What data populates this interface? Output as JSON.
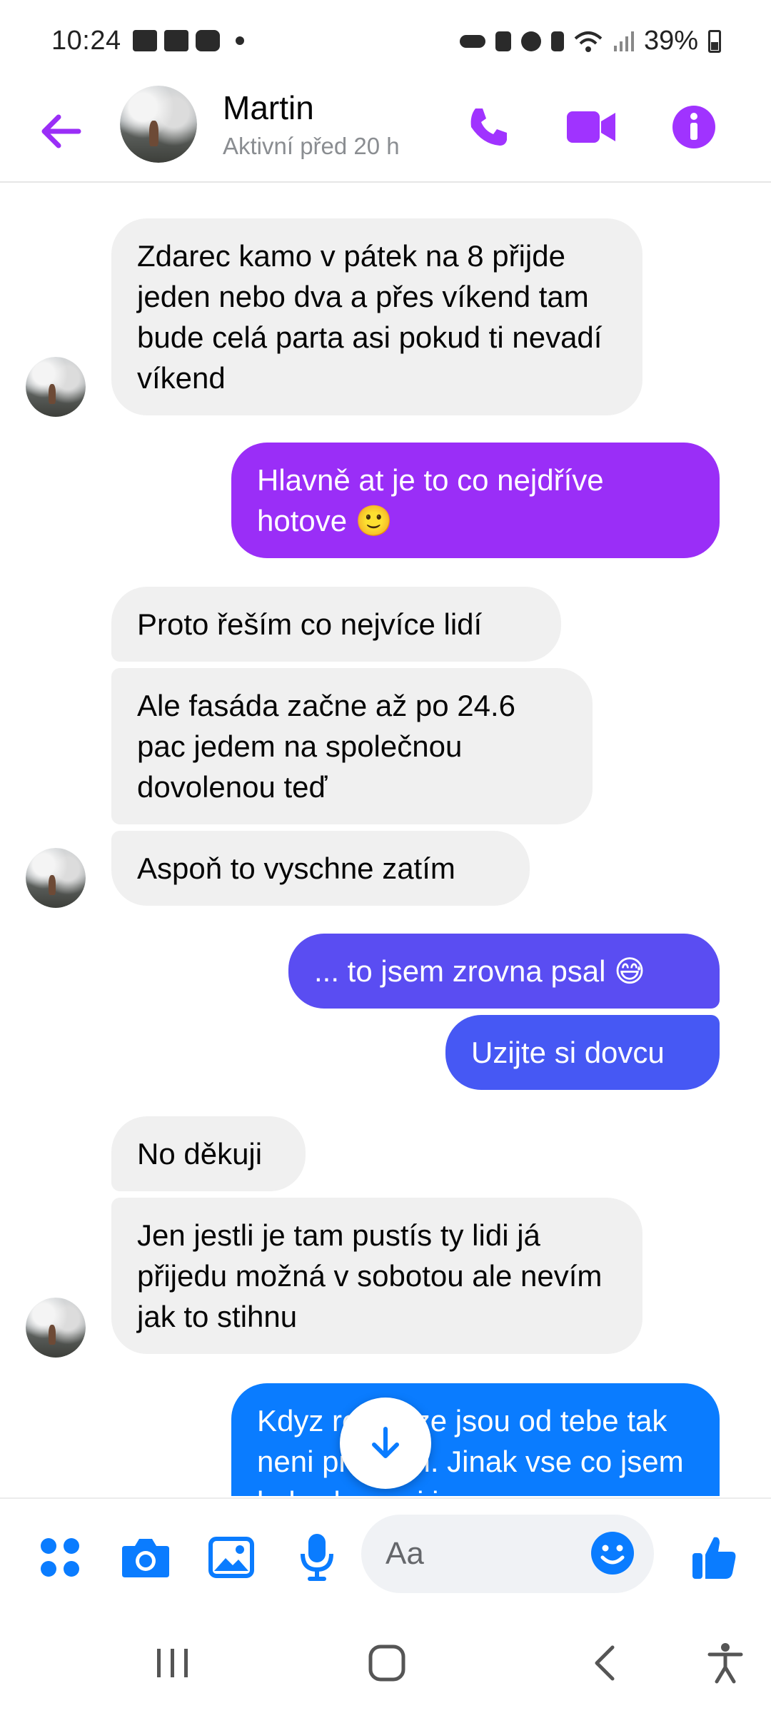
{
  "status_bar": {
    "time": "10:24",
    "battery": "39%"
  },
  "header": {
    "name": "Martin",
    "activity": "Aktivní před 20 h",
    "accent_color": "#a033ff"
  },
  "messages": [
    {
      "side": "in",
      "text": "Zdarec kamo v pátek na 8 přijde jeden nebo dva a přes víkend tam bude celá parta asi pokud ti nevadí víkend"
    },
    {
      "side": "out",
      "text": "Hlavně at je to co nejdříve hotove 🙂"
    },
    {
      "side": "in",
      "text": "Proto řeším co nejvíce lidí"
    },
    {
      "side": "in",
      "text": "Ale fasáda začne až po 24.6 pac jedem na společnou dovolenou teď"
    },
    {
      "side": "in",
      "text": "Aspoň to vyschne zatím"
    },
    {
      "side": "out",
      "text": "... to jsem zrovna psal 😅"
    },
    {
      "side": "out",
      "text": "Uzijte si dovcu"
    },
    {
      "side": "in",
      "text": "No děkuji"
    },
    {
      "side": "in",
      "text": "Jen jestli je tam pustís ty lidi já přijedu možná v sobotou ale nevím jak to stihnu"
    },
    {
      "side": "out",
      "text": "Kdyz rekou ze jsou od tebe tak neni problém.  Jinak vse co jsem byl schopnej jsem"
    }
  ],
  "composer": {
    "placeholder": "Aa"
  },
  "colors": {
    "bubble_in": "#f0f0f0",
    "out_purple": "#9a2ef7",
    "out_violet": "#5a4df2",
    "out_blue": "#0a7cff",
    "icon_blue": "#0a7cff"
  }
}
